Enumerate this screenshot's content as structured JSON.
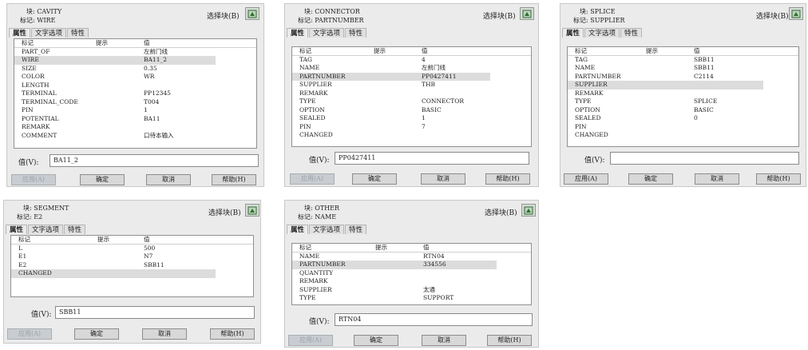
{
  "select_block_label": "选择块(B)",
  "tabs": [
    "属性",
    "文字选项",
    "特性"
  ],
  "columns": [
    "标记",
    "提示",
    "值"
  ],
  "value_label": "值(V):",
  "buttons": {
    "apply": "应用(A)",
    "ok": "确定",
    "cancel": "取消",
    "help": "帮助(H)"
  },
  "icons": {
    "select_block": "select-block-icon"
  },
  "dialogs": {
    "cavity": {
      "block_line": "块: CAVITY",
      "tag_line": "标记: WIRE",
      "rows": [
        {
          "tag": "PART_OF",
          "value": "左前门线"
        },
        {
          "tag": "WIRE",
          "value": "BA11_2"
        },
        {
          "tag": "SIZE",
          "value": "0.35"
        },
        {
          "tag": "COLOR",
          "value": "WR"
        },
        {
          "tag": "LENGTH",
          "value": ""
        },
        {
          "tag": "TERMINAL",
          "value": "PP12345"
        },
        {
          "tag": "TERMINAL_CODE",
          "value": "T004"
        },
        {
          "tag": "PIN",
          "value": "1"
        },
        {
          "tag": "POTENTIAL",
          "value": "BA11"
        },
        {
          "tag": "REMARK",
          "value": ""
        },
        {
          "tag": "COMMENT",
          "value": "口待本输入"
        }
      ],
      "value": "BA11_2"
    },
    "connector": {
      "block_line": "块: CONNECTOR",
      "tag_line": "标记: PARTNUMBER",
      "rows": [
        {
          "tag": "TAG",
          "value": "4"
        },
        {
          "tag": "NAME",
          "value": "左前门线"
        },
        {
          "tag": "PARTNUMBER",
          "value": "PP0427411"
        },
        {
          "tag": "SUPPLIER",
          "value": "THB"
        },
        {
          "tag": "REMARK",
          "value": ""
        },
        {
          "tag": "TYPE",
          "value": "CONNECTOR"
        },
        {
          "tag": "OPTION",
          "value": "BASIC"
        },
        {
          "tag": "SEALED",
          "value": "1"
        },
        {
          "tag": "PIN",
          "value": "7"
        },
        {
          "tag": "CHANGED",
          "value": ""
        }
      ],
      "value": "PP0427411"
    },
    "splice": {
      "block_line": "块: SPLICE",
      "tag_line": "标记: SUPPLIER",
      "rows": [
        {
          "tag": "TAG",
          "value": "SBB11"
        },
        {
          "tag": "NAME",
          "value": "SBB11"
        },
        {
          "tag": "PARTNUMBER",
          "value": "C2114"
        },
        {
          "tag": "SUPPLIER",
          "value": ""
        },
        {
          "tag": "REMARK",
          "value": ""
        },
        {
          "tag": "TYPE",
          "value": "SPLICE"
        },
        {
          "tag": "OPTION",
          "value": "BASIC"
        },
        {
          "tag": "SEALED",
          "value": "0"
        },
        {
          "tag": "PIN",
          "value": ""
        },
        {
          "tag": "CHANGED",
          "value": ""
        }
      ],
      "value": ""
    },
    "segment": {
      "block_line": "块: SEGMENT",
      "tag_line": "标记: E2",
      "rows": [
        {
          "tag": "L",
          "value": "500"
        },
        {
          "tag": "E1",
          "value": "N7"
        },
        {
          "tag": "E2",
          "value": "SBB11"
        },
        {
          "tag": "CHANGED",
          "value": ""
        }
      ],
      "value": "SBB11"
    },
    "other": {
      "block_line": "块: OTHER",
      "tag_line": "标记: NAME",
      "rows": [
        {
          "tag": "NAME",
          "value": "RTN04"
        },
        {
          "tag": "PARTNUMBER",
          "value": "334556"
        },
        {
          "tag": "QUANTITY",
          "value": ""
        },
        {
          "tag": "REMARK",
          "value": ""
        },
        {
          "tag": "SUPPLIER",
          "value": "太通"
        },
        {
          "tag": "TYPE",
          "value": "SUPPORT"
        }
      ],
      "value": "RTN04"
    }
  }
}
